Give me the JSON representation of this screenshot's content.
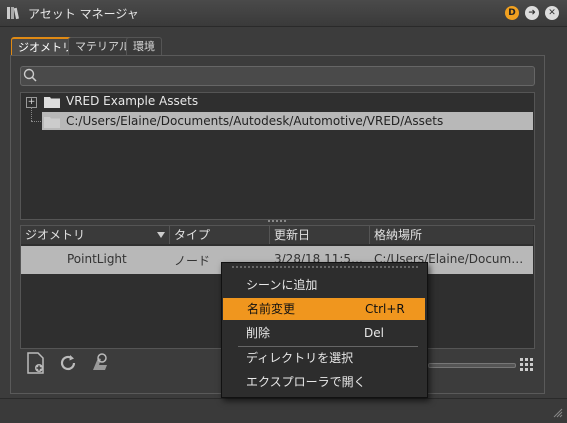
{
  "window": {
    "title": "アセット マネージャ",
    "accent": "#f0961e"
  },
  "titlebar_buttons": [
    {
      "label": "D",
      "icon": "d-badge-icon"
    },
    {
      "icon": "arrow-right-icon"
    },
    {
      "icon": "close-icon"
    }
  ],
  "tabs": [
    {
      "label": "ジオメトリ",
      "active": true
    },
    {
      "label": "マテリアル"
    },
    {
      "label": "環境"
    }
  ],
  "search": {
    "placeholder": "",
    "value": ""
  },
  "tree": {
    "items": [
      {
        "label": "VRED Example Assets",
        "icon": "folder-icon",
        "expander": "+"
      },
      {
        "label": "C:/Users/Elaine/Documents/Autodesk/Automotive/VRED/Assets",
        "icon": "folder-icon",
        "selected": true
      }
    ]
  },
  "table": {
    "columns": [
      "ジオメトリ",
      "タイプ",
      "更新日",
      "格納場所"
    ],
    "rows": [
      {
        "name": "PointLight",
        "type": "ノード",
        "date": "3/28/18 11:5…",
        "location": "C:/Users/Elaine/Docum…"
      }
    ]
  },
  "context_menu": {
    "items": [
      {
        "label": "シーンに追加",
        "shortcut": ""
      },
      {
        "label": "名前変更",
        "shortcut": "Ctrl+R",
        "highlighted": true
      },
      {
        "label": "削除",
        "shortcut": "Del"
      },
      {
        "label": "ディレクトリを選択",
        "shortcut": ""
      },
      {
        "label": "エクスプローラで開く",
        "shortcut": ""
      }
    ]
  },
  "bottom_toolbar": [
    {
      "icon": "new-file-icon"
    },
    {
      "icon": "refresh-icon"
    },
    {
      "icon": "clean-icon"
    }
  ]
}
